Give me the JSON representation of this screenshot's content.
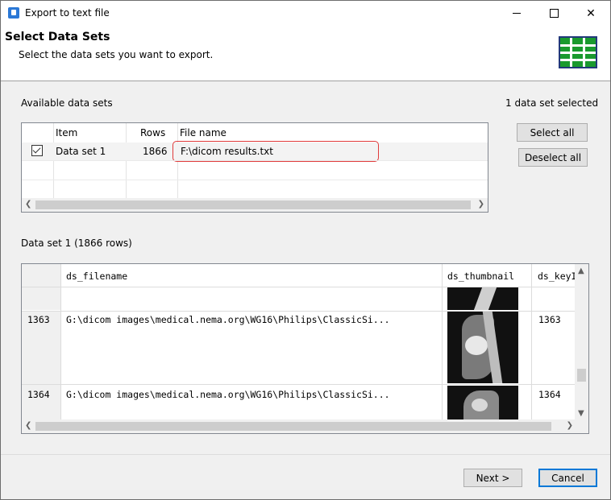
{
  "window": {
    "title": "Export to text file",
    "colors": {
      "header_bg": "#ffffff",
      "body_bg": "#f0f0f0",
      "highlight": "#e03a3a",
      "accent": "#0078d7",
      "icon_green": "#1a9a2e"
    }
  },
  "header": {
    "title": "Select Data Sets",
    "subtitle": "Select the data sets you want to export.",
    "icon": "table-grid-icon"
  },
  "datasets": {
    "label": "Available data sets",
    "selected_count": "1 data set selected",
    "columns": [
      "Item",
      "Rows",
      "File name"
    ],
    "rows": [
      {
        "checked": true,
        "item": "Data set 1",
        "rows": "1866",
        "file_name": "F:\\dicom results.txt"
      }
    ]
  },
  "buttons": {
    "select_all": "Select all",
    "deselect_all": "Deselect all",
    "next": "Next >",
    "cancel": "Cancel"
  },
  "preview": {
    "label": "Data set 1 (1866 rows)",
    "columns": [
      "ds_filename",
      "ds_thumbnail",
      "ds_keyID"
    ],
    "rows": [
      {
        "index": "1363",
        "filename": "G:\\dicom images\\medical.nema.org\\WG16\\Philips\\ClassicSi...",
        "key": "1363"
      },
      {
        "index": "1364",
        "filename": "G:\\dicom images\\medical.nema.org\\WG16\\Philips\\ClassicSi...",
        "key": "1364"
      }
    ]
  }
}
